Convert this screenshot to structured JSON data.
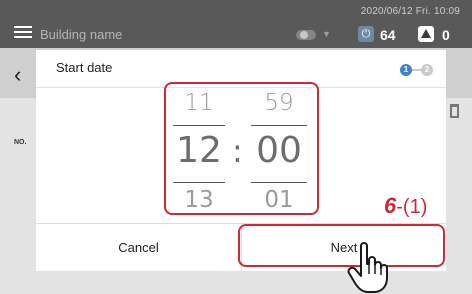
{
  "header": {
    "building_name": "Building name",
    "datetime": "2020/06/12 Fri. 10:09",
    "power_count": "64",
    "warning_count": "0"
  },
  "list": {
    "column_no": "NO."
  },
  "dialog": {
    "title": "Start date",
    "steps": [
      "1",
      "2"
    ],
    "current_step": 1,
    "time_picker": {
      "hour_prev": "11",
      "hour": "12",
      "hour_next": "13",
      "separator": ":",
      "minute_prev": "59",
      "minute": "00",
      "minute_next": "01"
    },
    "cancel_label": "Cancel",
    "next_label": "Next"
  },
  "annotation": {
    "step_number": "6",
    "step_sub": "-(1)",
    "highlight_color": "#cc2a36"
  },
  "colors": {
    "topbar": "#595959",
    "step_active": "#3d85c6",
    "step_inactive": "#c9c9c9"
  },
  "icons": [
    "menu-icon",
    "toggle-icon",
    "dropdown-triangle-icon",
    "power-icon",
    "warning-icon",
    "back-chevron-icon",
    "trash-icon",
    "hand-cursor-icon"
  ]
}
